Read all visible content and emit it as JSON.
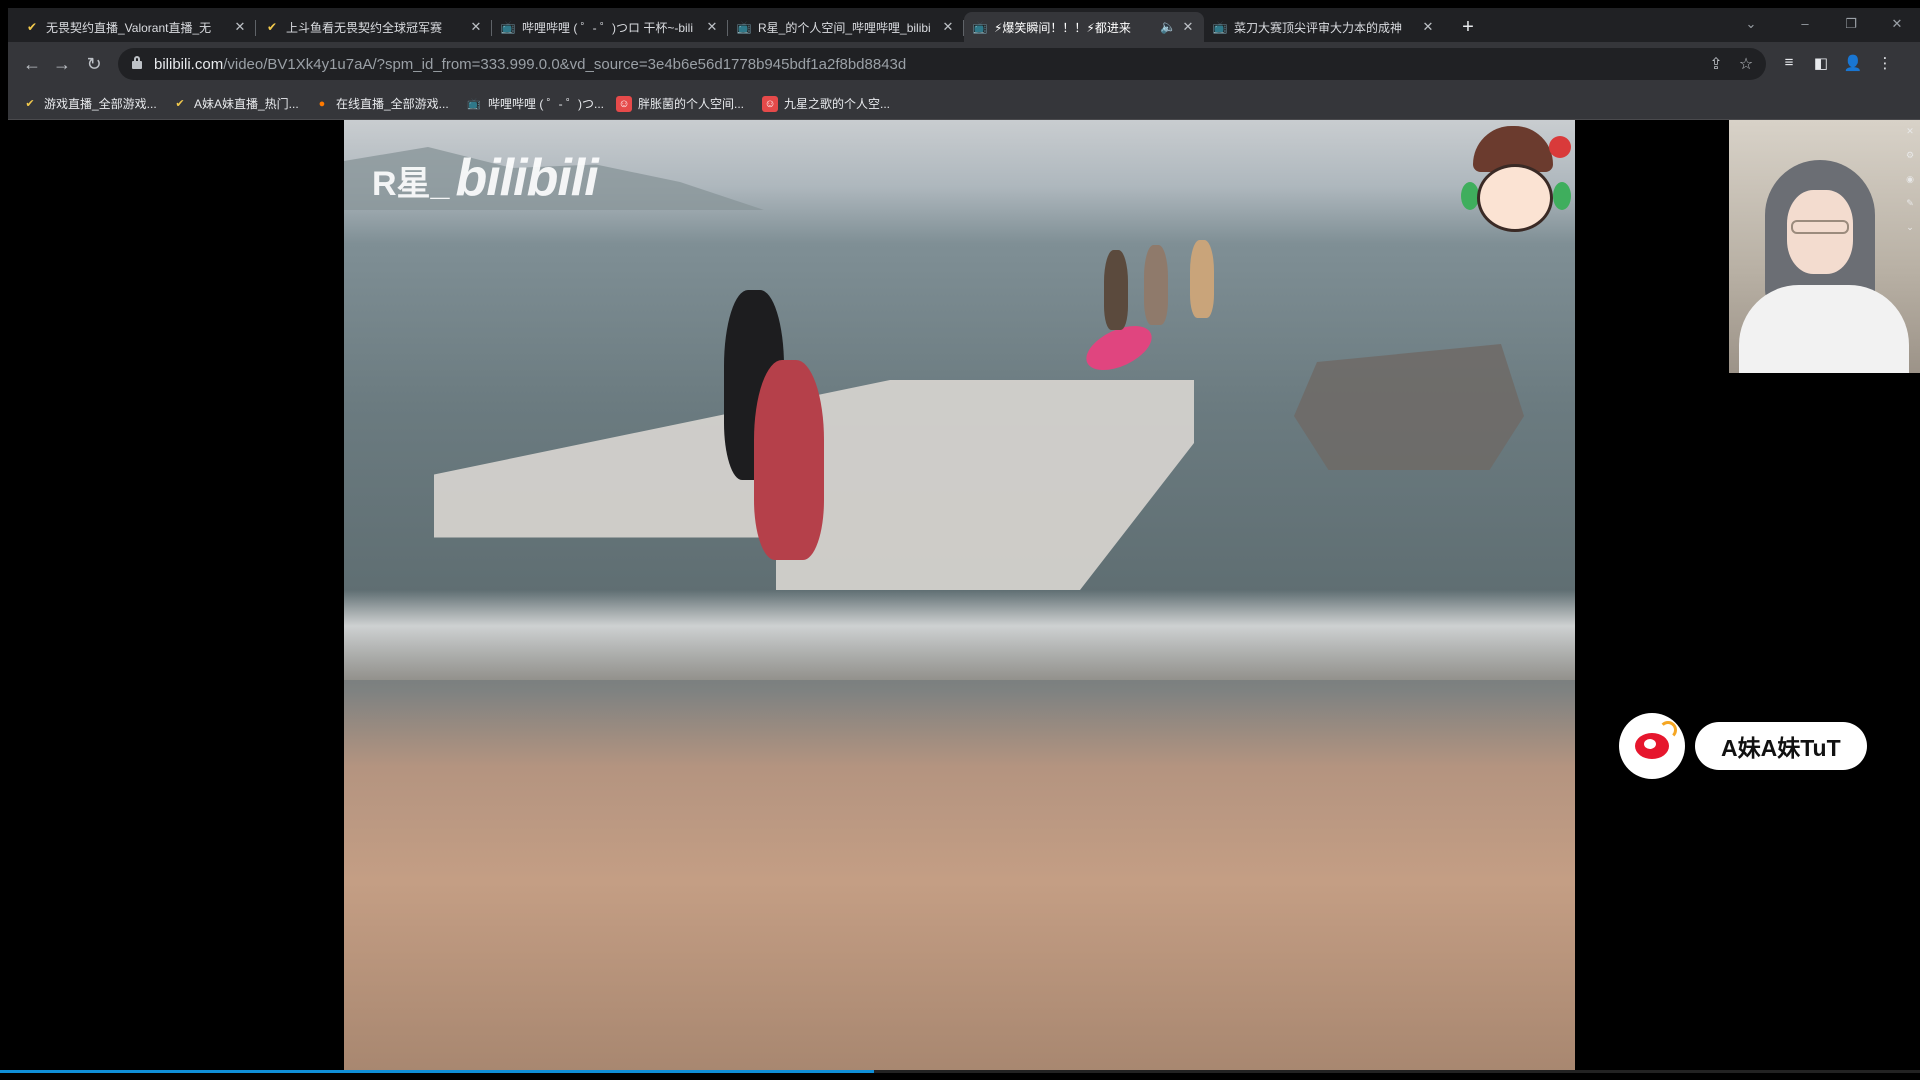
{
  "browser": {
    "tabs": [
      {
        "icon": "valorant-icon",
        "label": "无畏契约直播_Valorant直播_无",
        "active": false
      },
      {
        "icon": "valorant-icon",
        "label": "上斗鱼看无畏契约全球冠军赛",
        "active": false
      },
      {
        "icon": "bilibili-icon",
        "label": "哔哩哔哩 ( ゜- ゜)つロ 干杯~-bili",
        "active": false
      },
      {
        "icon": "bilibili-icon",
        "label": "R星_的个人空间_哔哩哔哩_bilibi",
        "active": false
      },
      {
        "icon": "bilibili-icon",
        "label": "⚡爆笑瞬间！！！⚡都进来",
        "active": true,
        "audio": true
      },
      {
        "icon": "bilibili-icon",
        "label": "菜刀大赛顶尖评审大力本的成神",
        "active": false
      }
    ],
    "newtab_label": "+",
    "window_controls": {
      "tabsearch": "⌄",
      "minimize": "–",
      "restore": "❐",
      "close": "✕"
    },
    "url": {
      "host": "bilibili.com",
      "path": "/video/BV1Xk4y1u7aA/?spm_id_from=333.999.0.0&vd_source=3e4b6e56d1778b945bdf1a2f8bd8843d"
    },
    "bookmarks": [
      {
        "icon": "valorant-icon",
        "label": "游戏直播_全部游戏..."
      },
      {
        "icon": "valorant-icon",
        "label": "A妹A妹直播_热门..."
      },
      {
        "icon": "douyu-icon",
        "label": "在线直播_全部游戏..."
      },
      {
        "icon": "bilibili-icon",
        "label": "哔哩哔哩 ( ゜- ゜)つ..."
      },
      {
        "icon": "profile-red-icon",
        "label": "胖胀菌的个人空间..."
      },
      {
        "icon": "profile-red-icon",
        "label": "九星之歌的个人空..."
      }
    ]
  },
  "video": {
    "watermark_author": "R星_",
    "watermark_brand": "bilibili",
    "progress_fraction": 0.455
  },
  "weibo": {
    "handle": "A妹A妹TuT"
  },
  "colors": {
    "progress": "#0f8fd8",
    "weibo_red": "#e6162d",
    "tab_bar": "#202124",
    "toolbar": "#35363a"
  }
}
